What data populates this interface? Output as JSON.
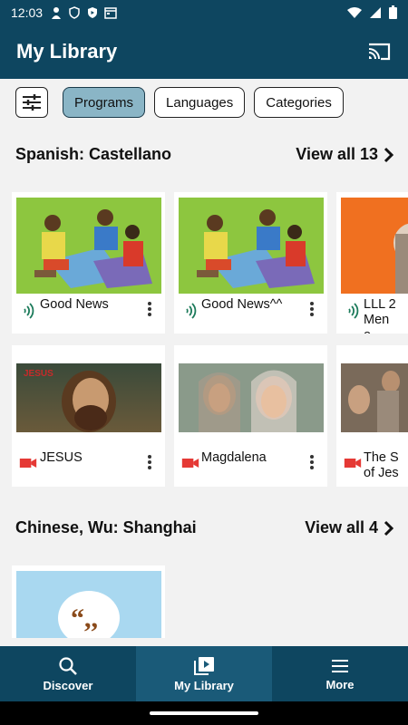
{
  "status_bar": {
    "time": "12:03"
  },
  "app_bar": {
    "title": "My Library"
  },
  "filters": {
    "chips": [
      {
        "label": "Programs",
        "active": true
      },
      {
        "label": "Languages",
        "active": false
      },
      {
        "label": "Categories",
        "active": false
      }
    ]
  },
  "sections": [
    {
      "title": "Spanish: Castellano",
      "view_all": "View all 13",
      "rows": [
        [
          {
            "label": "Good News",
            "type": "audio"
          },
          {
            "label": "Good News^^",
            "type": "audio"
          },
          {
            "label": "LLL 2 Men o",
            "type": "audio"
          }
        ],
        [
          {
            "label": "JESUS",
            "type": "video"
          },
          {
            "label": "Magdalena",
            "type": "video"
          },
          {
            "label": "The S of Jes",
            "type": "video"
          }
        ]
      ]
    },
    {
      "title": "Chinese, Wu: Shanghai",
      "view_all": "View all 4",
      "rows": [
        [
          {
            "label": "",
            "type": "audio"
          }
        ]
      ]
    }
  ],
  "thumbs": {
    "jesus_overlay": "JESUS"
  },
  "bottom_nav": {
    "items": [
      {
        "label": "Discover",
        "icon": "search-icon",
        "active": false
      },
      {
        "label": "My Library",
        "icon": "library-icon",
        "active": true
      },
      {
        "label": "More",
        "icon": "menu-icon",
        "active": false
      }
    ]
  },
  "colors": {
    "primary": "#0e4660",
    "chip_active": "#8ab5c6",
    "video_icon": "#e53935",
    "audio_icon": "#1b7a5a"
  }
}
